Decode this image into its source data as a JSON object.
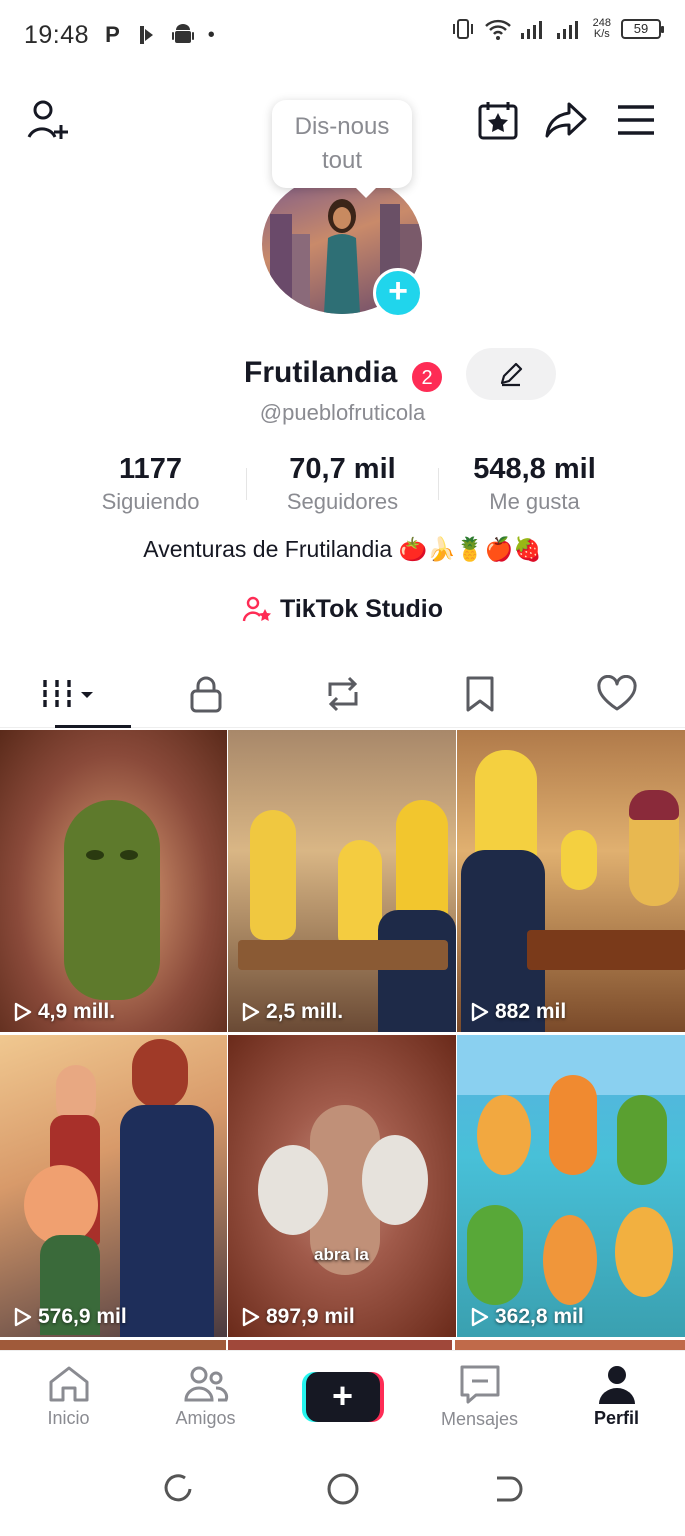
{
  "status_bar": {
    "time": "19:48",
    "left_icons": [
      "P"
    ],
    "speed_value": "248",
    "speed_unit": "K/s",
    "battery": "59",
    "dot": "•"
  },
  "tooltip": {
    "line1": "Dis-nous",
    "line2": "tout"
  },
  "profile": {
    "name": "Frutilandia",
    "badge": "2",
    "handle": "@pueblofruticola",
    "bio": "Aventuras de Frutilandia 🍅🍌🍍🍎🍓",
    "studio_label": "TikTok Studio"
  },
  "stats": [
    {
      "value": "1177",
      "label": "Siguiendo"
    },
    {
      "value": "70,7 mil",
      "label": "Seguidores"
    },
    {
      "value": "548,8 mil",
      "label": "Me gusta"
    }
  ],
  "tabs": [
    {
      "icon": "videos-grid-icon",
      "active": true
    },
    {
      "icon": "lock-icon",
      "active": false
    },
    {
      "icon": "repost-icon",
      "active": false
    },
    {
      "icon": "bookmark-icon",
      "active": false
    },
    {
      "icon": "heart-icon",
      "active": false
    }
  ],
  "videos": [
    {
      "views": "4,9 mill."
    },
    {
      "views": "2,5 mill."
    },
    {
      "views": "882 mil"
    },
    {
      "views": "576,9 mil"
    },
    {
      "views": "897,9 mil"
    },
    {
      "views": "362,8 mil"
    }
  ],
  "overlay_text": {
    "video5": "abra la"
  },
  "bottom_nav": [
    {
      "label": "Inicio",
      "icon": "home-icon"
    },
    {
      "label": "Amigos",
      "icon": "friends-icon"
    },
    {
      "label": "",
      "icon": "create-icon"
    },
    {
      "label": "Mensajes",
      "icon": "messages-icon"
    },
    {
      "label": "Perfil",
      "icon": "profile-icon"
    }
  ],
  "colors": {
    "accent_pink": "#fe2c55",
    "accent_cyan": "#25f4ee",
    "text_primary": "#161823",
    "text_secondary": "#8a8b91"
  }
}
